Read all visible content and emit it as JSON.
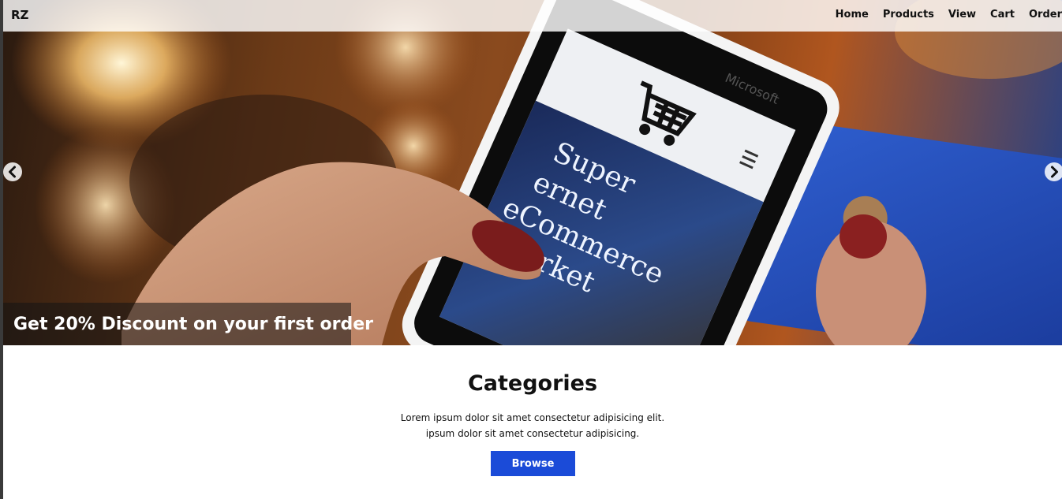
{
  "navbar": {
    "brand": "RZ",
    "links": [
      {
        "label": "Home"
      },
      {
        "label": "Products"
      },
      {
        "label": "View"
      },
      {
        "label": "Cart"
      },
      {
        "label": "Order"
      }
    ]
  },
  "hero": {
    "caption": "Get 20% Discount on your first order",
    "prev_icon": "chevron-left-icon",
    "next_icon": "chevron-right-icon",
    "phone_brand": "Microsoft",
    "screen_text": [
      "Super",
      "ernet",
      "eCommerce",
      "Market"
    ]
  },
  "categories": {
    "title": "Categories",
    "desc_line1": "Lorem ipsum dolor sit amet consectetur adipisicing elit.",
    "desc_line2": "ipsum dolor sit amet consectetur adipisicing.",
    "button_label": "Browse",
    "button_color": "#1b4bd8"
  }
}
